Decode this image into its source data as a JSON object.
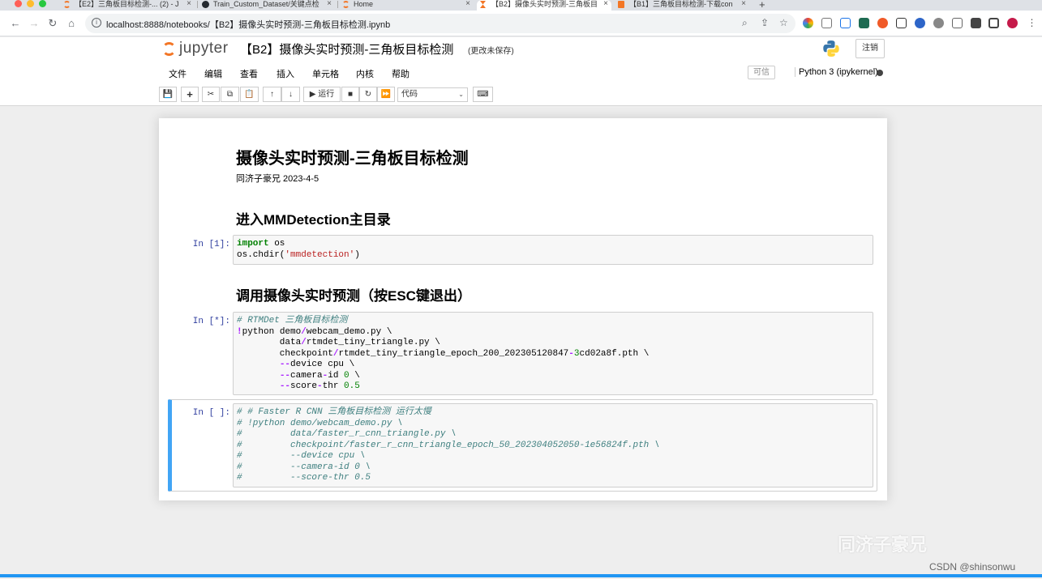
{
  "browser": {
    "tabs": [
      {
        "title": "【E2】三角板目标检测-... (2) - J",
        "favicon_color": "#f37626"
      },
      {
        "title": "Train_Custom_Dataset/关键点检",
        "favicon_color": "#24292f"
      },
      {
        "title": "Home",
        "favicon_color": "#f37626"
      },
      {
        "title": "【B2】摄像头实时预测-三角板目",
        "favicon_color": "#f37626"
      },
      {
        "title": "【B1】三角板目标检测-下载con",
        "favicon_color": "#f37626"
      }
    ],
    "close_glyph": "×",
    "new_tab_glyph": "+",
    "url": "localhost:8888/notebooks/【B2】摄像头实时预测-三角板目标检测.ipynb",
    "info_glyph": "i",
    "nav_glyphs": {
      "back": "←",
      "forward": "→",
      "reload": "↻",
      "home": "⌂"
    },
    "omnibox_glyphs": {
      "zoom": "⌕",
      "share": "⇪",
      "bookmark": "☆"
    }
  },
  "jupyter": {
    "logo_text": "jupyter",
    "notebook_title": "【B2】摄像头实时预测-三角板目标检测",
    "save_status": "(更改未保存)",
    "logout_label": "注销",
    "menu": [
      "文件",
      "编辑",
      "查看",
      "插入",
      "单元格",
      "内核",
      "帮助"
    ],
    "trusted_label": "可信",
    "kernel_name": "Python 3 (ipykernel)",
    "toolbar": {
      "save": "💾",
      "add": "+",
      "cut": "✂",
      "copy": "⧉",
      "paste": "📋",
      "up": "↑",
      "down": "↓",
      "run": "▶ 运行",
      "stop": "■",
      "restart": "↻",
      "fastforward": "⏩",
      "cell_type": "代码",
      "cell_type_caret": "⌄",
      "keyboard": "⌨"
    }
  },
  "notebook": {
    "title": "摄像头实时预测-三角板目标检测",
    "author_line": "同济子豪兄 2023-4-5",
    "heading1": "进入MMDetection主目录",
    "heading2": "调用摄像头实时预测（按ESC键退出）",
    "cell1_prompt": "In [1]:",
    "cell2_prompt": "In [*]:",
    "cell3_prompt": "In [ ]:"
  },
  "watermark": {
    "text": "同济子豪兄",
    "csdn": "CSDN @shinsonwu"
  }
}
